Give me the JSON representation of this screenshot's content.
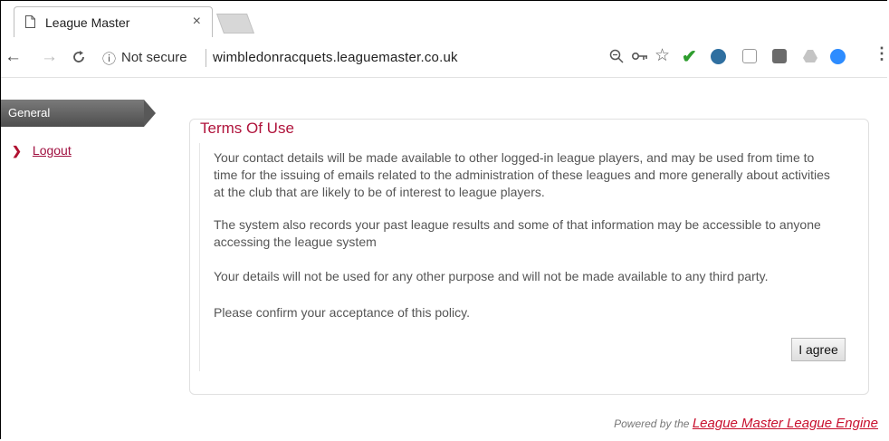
{
  "browser": {
    "tab_title": "League Master",
    "tab_close": "×",
    "security_label": "Not secure",
    "url": "wimbledonracquets.leaguemaster.co.uk"
  },
  "sidebar": {
    "section": "General",
    "items": [
      {
        "label": "Logout"
      }
    ]
  },
  "terms": {
    "title": "Terms Of Use",
    "paragraphs": [
      "Your contact details will be made available to other logged-in league players, and may be used from time to time for the issuing of emails related to the administration of these leagues and more generally about activities at the club that are likely to be of interest to league players.",
      "The system also records your past league results and some of that information may be accessible to anyone accessing the league system",
      "Your details will not be used for any other purpose and will not be made available to any third party.",
      "Please confirm your acceptance of this policy."
    ],
    "agree_label": "I agree"
  },
  "footer": {
    "prefix": "Powered by the",
    "link": "League Master League Engine"
  }
}
